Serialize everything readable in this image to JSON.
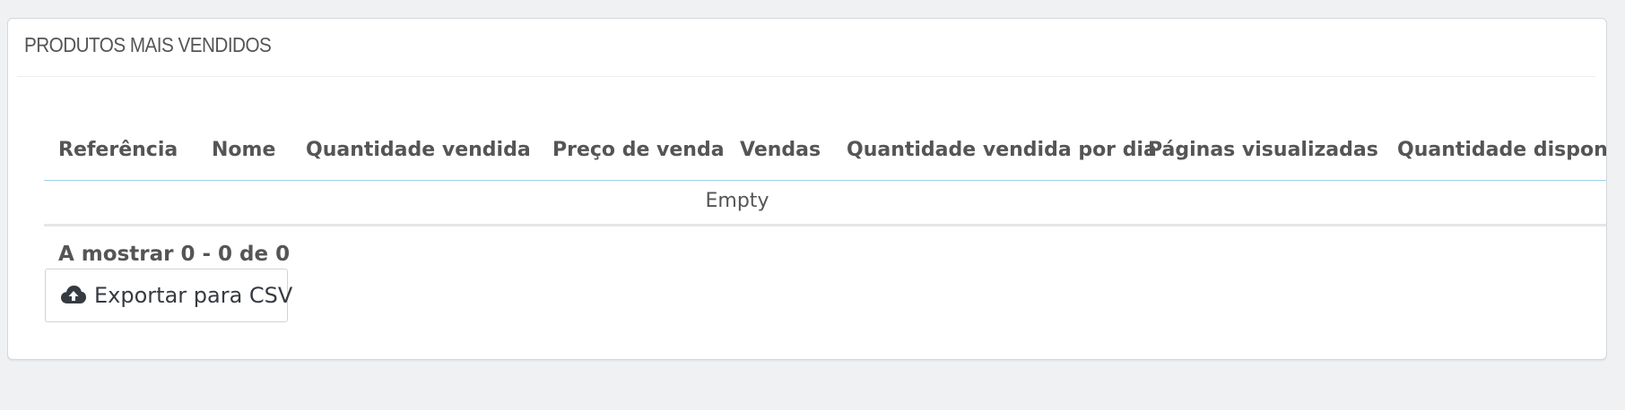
{
  "panel": {
    "title": "PRODUTOS MAIS VENDIDOS"
  },
  "table": {
    "columns": [
      "Referência",
      "Nome",
      "Quantidade vendida",
      "Preço de venda",
      "Vendas",
      "Quantidade vendida por dia",
      "Páginas visualizadas",
      "Quantidade dispon"
    ],
    "empty_text": "Empty"
  },
  "pagination": {
    "info": "A mostrar 0 - 0 de 0"
  },
  "export": {
    "label": "Exportar para CSV",
    "icon": "cloud-upload-icon"
  },
  "colors": {
    "background": "#eff1f2",
    "text": "#555555",
    "header_border": "#a0d0eb"
  }
}
